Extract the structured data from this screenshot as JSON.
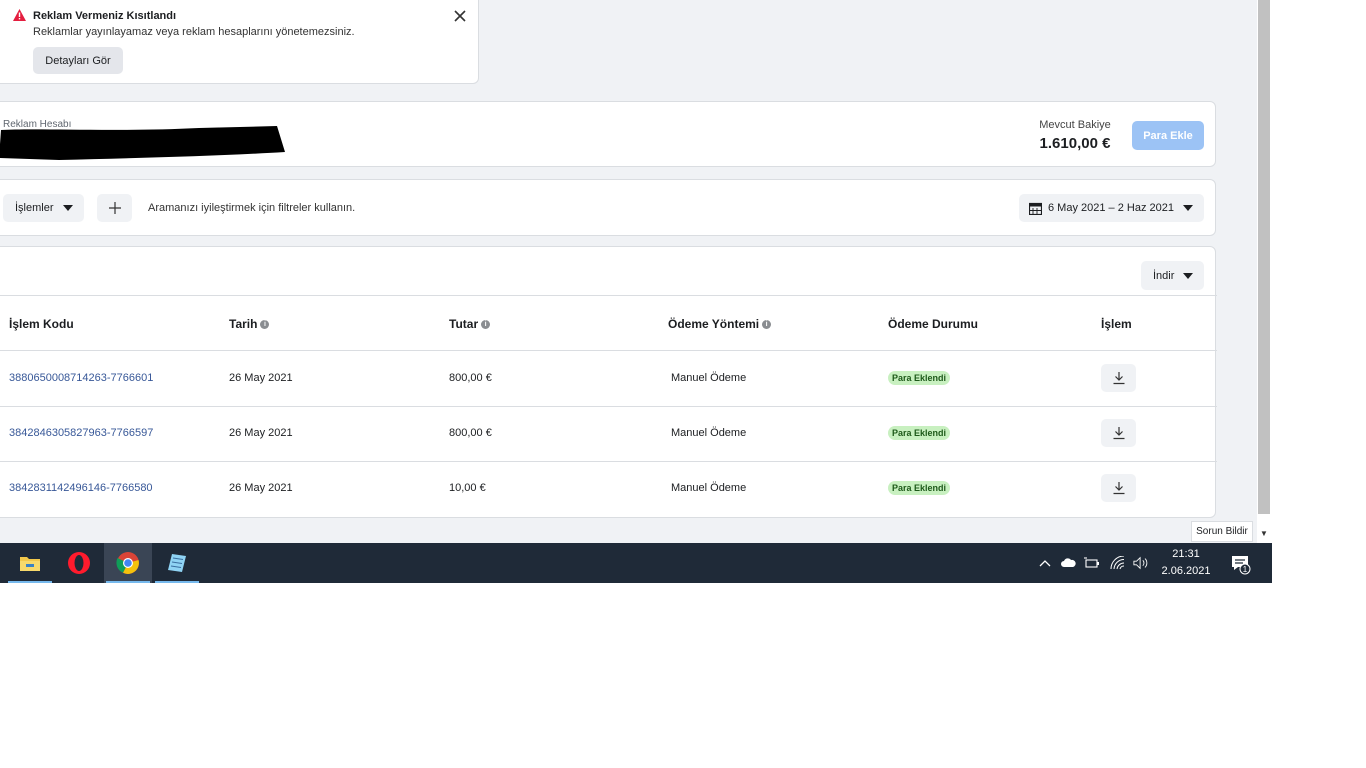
{
  "alert": {
    "title": "Reklam Vermeniz Kısıtlandı",
    "text": "Reklamlar yayınlayamaz veya reklam hesaplarını yönetemezsiniz.",
    "details_button": "Detayları Gör"
  },
  "account": {
    "label": "Reklam Hesabı",
    "balance_label": "Mevcut Bakiye",
    "balance_value": "1.610,00 €",
    "add_money_button": "Para Ekle"
  },
  "filters": {
    "transactions_dropdown": "İşlemler",
    "hint": "Aramanızı iyileştirmek için filtreler kullanın.",
    "date_range": "6 May 2021 – 2 Haz 2021"
  },
  "table": {
    "download_dropdown": "İndir",
    "headers": {
      "code": "İşlem Kodu",
      "date": "Tarih",
      "amount": "Tutar",
      "method": "Ödeme Yöntemi",
      "status": "Ödeme Durumu",
      "action": "İşlem"
    },
    "rows": [
      {
        "code": "3880650008714263-7766601",
        "date": "26 May 2021",
        "amount": "800,00 €",
        "method": "Manuel Ödeme",
        "status": "Para Eklendi"
      },
      {
        "code": "3842846305827963-7766597",
        "date": "26 May 2021",
        "amount": "800,00 €",
        "method": "Manuel Ödeme",
        "status": "Para Eklendi"
      },
      {
        "code": "3842831142496146-7766580",
        "date": "26 May 2021",
        "amount": "10,00 €",
        "method": "Manuel Ödeme",
        "status": "Para Eklendi"
      }
    ]
  },
  "report_button": "Sorun Bildir",
  "taskbar": {
    "apps": [
      "file-explorer-icon",
      "opera-icon",
      "chrome-icon",
      "notepad-icon"
    ],
    "time": "21:31",
    "date": "2.06.2021",
    "notification_count": "1"
  },
  "colors": {
    "link": "#385898",
    "primary_disabled": "#9cc3f5",
    "badge_bg": "#c8f0c0",
    "warning": "#e9710f",
    "taskbar": "#1f2a38"
  }
}
